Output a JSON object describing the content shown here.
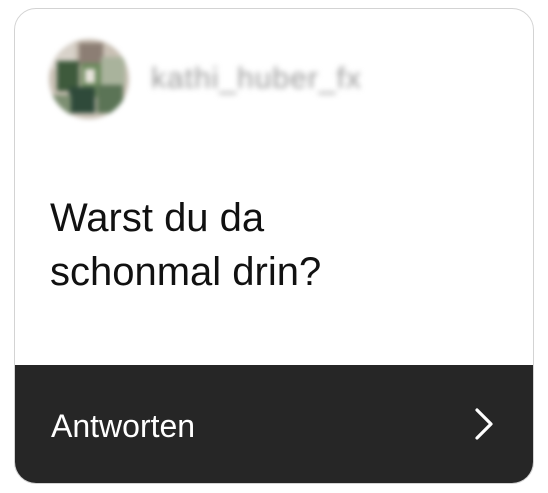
{
  "sender": {
    "username": "kathi_huber_fx",
    "avatar_icon": "profile-photo-icon"
  },
  "question": {
    "text": "Warst du da\nschonmal drin?"
  },
  "reply": {
    "label": "Antworten",
    "icon": "chevron-right-icon"
  },
  "colors": {
    "footer_bg": "#262626",
    "text_dark": "#111111",
    "text_light": "#ffffff",
    "border": "#d3d3d3"
  }
}
